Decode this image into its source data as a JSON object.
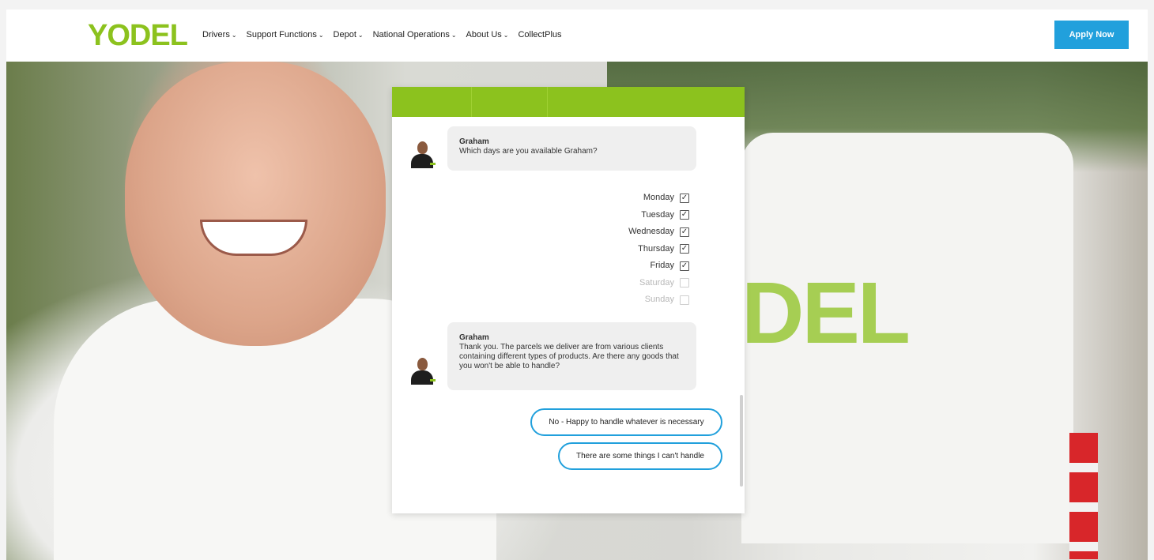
{
  "header": {
    "logo": "YODEL",
    "nav": [
      {
        "label": "Drivers",
        "chevron": "⌄"
      },
      {
        "label": "Support Functions",
        "chevron": "⌄"
      },
      {
        "label": "Depot",
        "chevron": "⌄"
      },
      {
        "label": "National Operations",
        "chevron": "⌄"
      },
      {
        "label": "About Us",
        "chevron": "⌄"
      },
      {
        "label": "CollectPlus",
        "chevron": ""
      }
    ],
    "apply_label": "Apply Now"
  },
  "hero": {
    "van_text": "DEL"
  },
  "chat": {
    "messages": [
      {
        "name": "Graham",
        "text": "Which days are you available Graham?"
      },
      {
        "name": "Graham",
        "text": "Thank you.  The parcels we deliver are from various clients containing different types of products. Are there any goods that you won't be able to handle?"
      }
    ],
    "days": [
      {
        "label": "Monday",
        "checked": true
      },
      {
        "label": "Tuesday",
        "checked": true
      },
      {
        "label": "Wednesday",
        "checked": true
      },
      {
        "label": "Thursday",
        "checked": true
      },
      {
        "label": "Friday",
        "checked": true
      },
      {
        "label": "Saturday",
        "checked": false
      },
      {
        "label": "Sunday",
        "checked": false
      }
    ],
    "replies": [
      "No - Happy to handle whatever is necessary",
      "There are some things I can't handle"
    ],
    "check_glyph": "✓"
  },
  "colors": {
    "brand_green": "#8cc21e",
    "accent_blue": "#21a0dc"
  }
}
